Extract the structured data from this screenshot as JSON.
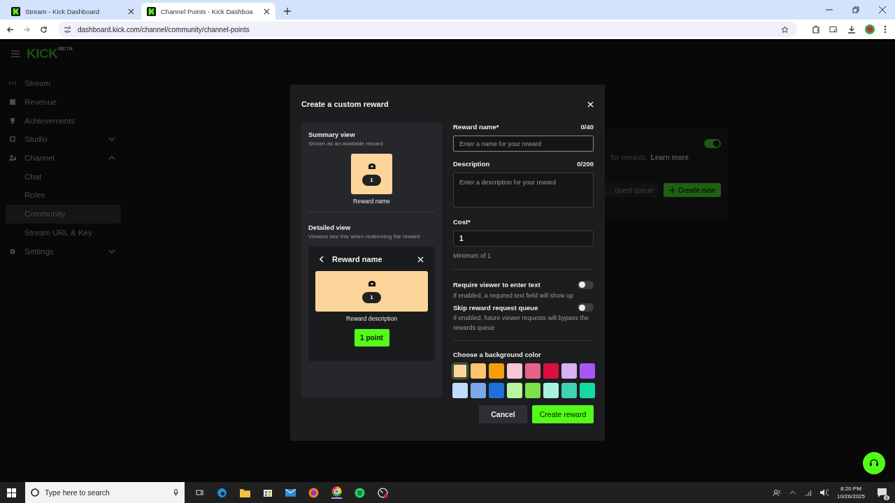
{
  "browser": {
    "tabs": [
      {
        "title": "Stream - Kick Dashboard",
        "selected": false
      },
      {
        "title": "Channel Points - Kick Dashboa",
        "selected": true
      }
    ],
    "url": "dashboard.kick.com/channel/community/channel-points"
  },
  "app": {
    "logo": "KICK",
    "logo_badge": "BETA",
    "sidebar": [
      {
        "kind": "item",
        "label": "Stream"
      },
      {
        "kind": "item",
        "label": "Revenue"
      },
      {
        "kind": "item",
        "label": "Achievements"
      },
      {
        "kind": "group",
        "label": "Studio",
        "expanded": false
      },
      {
        "kind": "group",
        "label": "Channel",
        "expanded": true,
        "children": [
          {
            "label": "Chat",
            "selected": false
          },
          {
            "label": "Roles",
            "selected": false
          },
          {
            "label": "Community",
            "selected": true
          },
          {
            "label": "Stream URL & Key",
            "selected": false
          }
        ]
      },
      {
        "kind": "group",
        "label": "Settings",
        "expanded": false
      }
    ],
    "background": {
      "enabled_toggle_on": true,
      "hint": "for rewards.",
      "link": "Learn more",
      "queue_button": "quest queue",
      "create_button": "Create new"
    }
  },
  "modal": {
    "title": "Create a custom reward",
    "summary": {
      "title": "Summary view",
      "subtitle": "Shown as an available reward",
      "cost": "1",
      "name": "Reward name"
    },
    "detailed": {
      "title": "Detailed view",
      "subtitle": "Viewers see this when redeeming the reward",
      "header": "Reward name",
      "cost": "1",
      "description": "Reward description",
      "button": "1 point"
    },
    "name_field": {
      "label": "Reward name*",
      "counter": "0/40",
      "placeholder": "Enter a name for your reward"
    },
    "description_field": {
      "label": "Description",
      "counter": "0/200",
      "placeholder": "Enter a description for your reward"
    },
    "cost_field": {
      "label": "Cost*",
      "value": "1",
      "hint": "Minimum of 1"
    },
    "toggles": [
      {
        "label": "Require viewer to enter text",
        "hint": "If enabled, a required text field will show up",
        "on": false
      },
      {
        "label": "Skip reward request queue",
        "hint": "If enabled, future viewer requests will bypass the rewards queue",
        "on": false
      }
    ],
    "color_title": "Choose a background color",
    "colors": [
      {
        "color": "#fdd59b",
        "selected": true
      },
      {
        "color": "#fbc46f",
        "selected": false
      },
      {
        "color": "#f59e0b",
        "selected": false
      },
      {
        "color": "#f9c6d6",
        "selected": false
      },
      {
        "color": "#e8638a",
        "selected": false
      },
      {
        "color": "#d90f3f",
        "selected": false
      },
      {
        "color": "#d9b1f7",
        "selected": false
      },
      {
        "color": "#a855f7",
        "selected": false
      },
      {
        "color": "#bfdbfe",
        "selected": false
      },
      {
        "color": "#7aa8e8",
        "selected": false
      },
      {
        "color": "#1e6fd9",
        "selected": false
      },
      {
        "color": "#b7f5a0",
        "selected": false
      },
      {
        "color": "#7ee04a",
        "selected": false
      },
      {
        "color": "#a7f3e0",
        "selected": false
      },
      {
        "color": "#3fd3b3",
        "selected": false
      },
      {
        "color": "#14d9a4",
        "selected": false
      }
    ],
    "cancel": "Cancel",
    "submit": "Create reward"
  },
  "taskbar": {
    "search_placeholder": "Type here to search",
    "time": "8:20 PM",
    "date": "10/26/2025",
    "notifications": "4"
  }
}
